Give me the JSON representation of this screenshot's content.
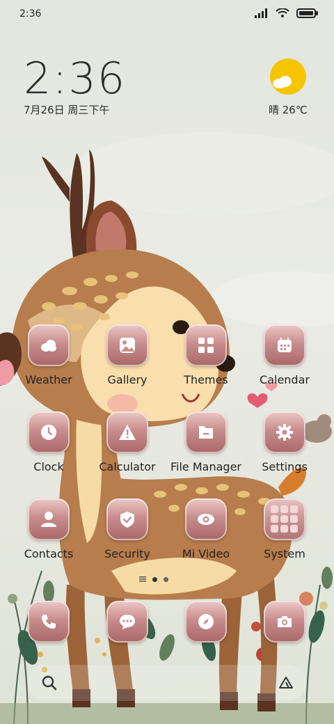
{
  "status_bar": {
    "time": "2:36"
  },
  "clock": {
    "time": "2:36",
    "date": "7月26日 周三下午"
  },
  "weather": {
    "text": "晴 26℃"
  },
  "apps": [
    {
      "label": "Weather",
      "icon": "weather-icon"
    },
    {
      "label": "Gallery",
      "icon": "gallery-icon"
    },
    {
      "label": "Themes",
      "icon": "themes-icon"
    },
    {
      "label": "Calendar",
      "icon": "calendar-icon"
    },
    {
      "label": "Clock",
      "icon": "clock-icon"
    },
    {
      "label": "Calculator",
      "icon": "calculator-icon"
    },
    {
      "label": "File Manager",
      "icon": "file-manager-icon"
    },
    {
      "label": "Settings",
      "icon": "settings-icon"
    },
    {
      "label": "Contacts",
      "icon": "contacts-icon"
    },
    {
      "label": "Security",
      "icon": "security-icon"
    },
    {
      "label": "Mi Video",
      "icon": "mi-video-icon"
    },
    {
      "label": "System",
      "icon": "system-folder-icon"
    }
  ],
  "dock": [
    {
      "icon": "phone-icon"
    },
    {
      "icon": "messages-icon"
    },
    {
      "icon": "browser-icon"
    },
    {
      "icon": "camera-icon"
    }
  ],
  "colors": {
    "tile_top": "#ecc9c8",
    "tile_bottom": "#a86767",
    "sun": "#f7c400"
  }
}
